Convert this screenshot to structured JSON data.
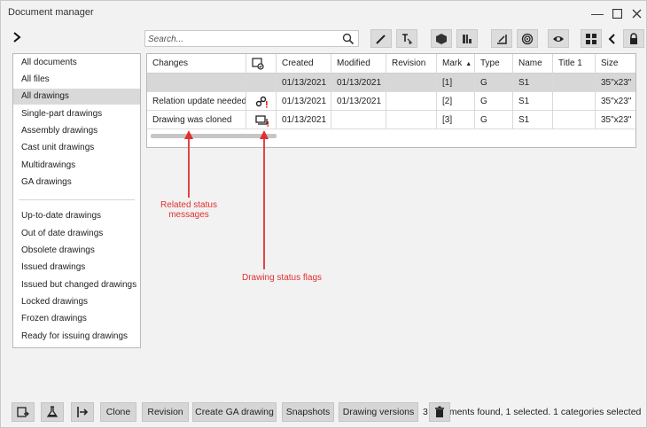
{
  "window": {
    "title": "Document manager"
  },
  "search": {
    "placeholder": "Search..."
  },
  "nav": {
    "group1": [
      "All documents",
      "All files",
      "All drawings",
      "Single-part drawings",
      "Assembly drawings",
      "Cast unit drawings",
      "Multidrawings",
      "GA drawings"
    ],
    "group2": [
      "Up-to-date drawings",
      "Out of date drawings",
      "Obsolete drawings",
      "Issued drawings",
      "Issued but changed drawings",
      "Locked drawings",
      "Frozen drawings",
      "Ready for issuing drawings"
    ],
    "selected": "All drawings"
  },
  "table": {
    "columns": [
      "Changes",
      "",
      "Created",
      "Modified",
      "Revision",
      "Mark",
      "Type",
      "Name",
      "Title 1",
      "Size"
    ],
    "sorted_column": "Mark",
    "rows": [
      {
        "changes": "",
        "flag_icon": "",
        "created": "01/13/2021",
        "modified": "01/13/2021",
        "revision": "",
        "mark": "[1]",
        "type": "G",
        "name": "S1",
        "title1": "",
        "size": "35\"x23\""
      },
      {
        "changes": "Relation update needed",
        "flag_icon": "relation-update-flag-icon",
        "created": "01/13/2021",
        "modified": "01/13/2021",
        "revision": "",
        "mark": "[2]",
        "type": "G",
        "name": "S1",
        "title1": "",
        "size": "35\"x23\""
      },
      {
        "changes": "Drawing was cloned",
        "flag_icon": "cloned-flag-icon",
        "created": "01/13/2021",
        "modified": "",
        "revision": "",
        "mark": "[3]",
        "type": "G",
        "name": "S1",
        "title1": "",
        "size": "35\"x23\""
      }
    ]
  },
  "annotations": {
    "related": [
      "Related status",
      "messages"
    ],
    "flags": "Drawing status flags",
    "color": "#e23030"
  },
  "bottom": {
    "buttons": [
      "Clone",
      "Revision",
      "Create GA drawing",
      "Snapshots",
      "Drawing versions"
    ],
    "status_prefix": "3",
    "status_suffix": "ments found, 1 selected. 1 categories selected"
  }
}
